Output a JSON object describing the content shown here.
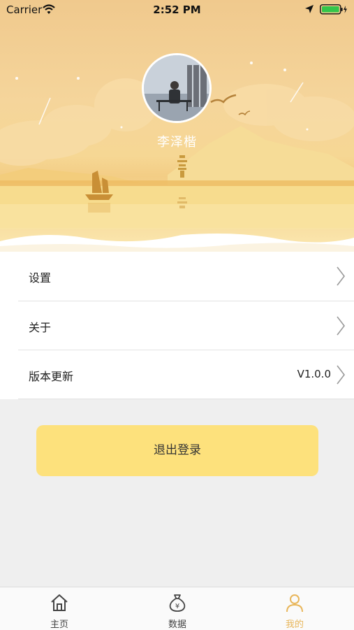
{
  "status_bar": {
    "carrier": "Carrier",
    "time": "2:52 PM"
  },
  "profile": {
    "name": "李泽楷"
  },
  "menu": {
    "items": [
      {
        "label": "设置",
        "value": ""
      },
      {
        "label": "关于",
        "value": ""
      },
      {
        "label": "版本更新",
        "value": "V1.0.0"
      }
    ]
  },
  "logout": {
    "label": "退出登录"
  },
  "tab_bar": {
    "tabs": [
      {
        "label": "主页",
        "icon": "home-icon",
        "active": false
      },
      {
        "label": "数据",
        "icon": "money-bag-icon",
        "active": false
      },
      {
        "label": "我的",
        "icon": "person-icon",
        "active": true
      }
    ]
  },
  "colors": {
    "accent": "#fde17c",
    "active_tab": "#e8b65a",
    "inactive_tab": "#444444",
    "header_gradient_top": "#f0c98d"
  }
}
